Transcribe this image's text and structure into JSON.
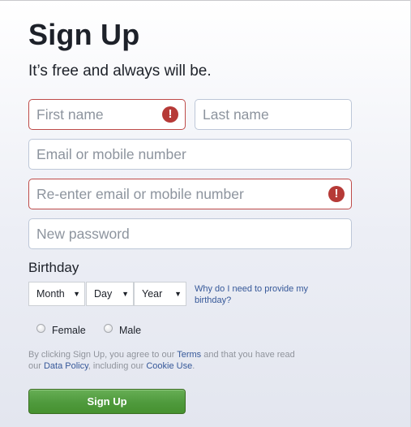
{
  "header": {
    "title": "Sign Up",
    "subtitle": "It’s free and always will be."
  },
  "form": {
    "first_name": {
      "placeholder": "First name",
      "value": "",
      "error": true
    },
    "last_name": {
      "placeholder": "Last name",
      "value": "",
      "error": false
    },
    "email": {
      "placeholder": "Email or mobile number",
      "value": "",
      "error": false
    },
    "reenter_email": {
      "placeholder": "Re-enter email or mobile number",
      "value": "",
      "error": true
    },
    "password": {
      "placeholder": "New password",
      "value": "",
      "error": false
    },
    "error_icon_glyph": "!"
  },
  "birthday": {
    "label": "Birthday",
    "month": "Month",
    "day": "Day",
    "year": "Year",
    "arrow_glyph": "▼",
    "why_link": "Why do I need to provide my birthday?"
  },
  "gender": {
    "female": "Female",
    "male": "Male"
  },
  "terms": {
    "part1": "By clicking Sign Up, you agree to our ",
    "terms_link": "Terms",
    "part2": " and that you have read our ",
    "data_policy_link": "Data Policy",
    "part3": ", including our ",
    "cookie_link": "Cookie Use",
    "part4": "."
  },
  "buttons": {
    "signup": "Sign Up"
  },
  "colors": {
    "error_border": "#be4b49",
    "link": "#365899",
    "button_green": "#4f9a3d"
  }
}
